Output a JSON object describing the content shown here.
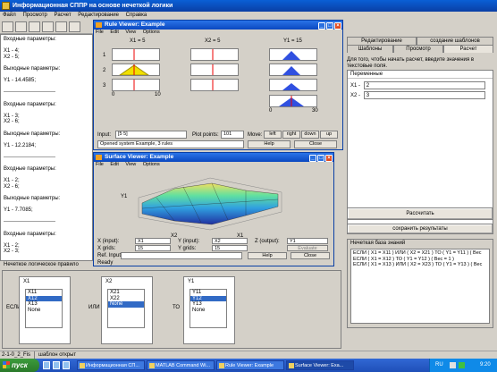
{
  "app": {
    "title": "Информационная СППР на основе нечеткой логики",
    "menu": [
      "Файл",
      "Просмотр",
      "Расчет",
      "Редактирование",
      "Справка"
    ]
  },
  "left_log": [
    "Входные параметры:",
    "",
    "X1 - 4;",
    "X2 - 5;",
    "",
    "Выходные параметры:",
    "",
    "Y1 - 14.4585;",
    "",
    "-----------------------------",
    "",
    "Входные параметры:",
    "",
    "X1 - 3;",
    "X2 - 6;",
    "",
    "Выходные параметры:",
    "",
    "Y1 - 12.2184;",
    "",
    "-----------------------------",
    "",
    "Входные параметры:",
    "",
    "X1 - 2;",
    "X2 - 6;",
    "",
    "Выходные параметры:",
    "",
    "Y1 - 7.7085;",
    "",
    "-----------------------------",
    "",
    "Входные параметры:",
    "",
    "X1 - 2;",
    "X2 - 3;",
    "",
    "Выходные параметры:"
  ],
  "right": {
    "tabs_top": [
      "Редактирование",
      "создание шаблонов"
    ],
    "tabs_bottom": [
      "Шаблоны",
      "Просмотр",
      "Расчет"
    ],
    "hint": "Для того, чтобы начать расчет, введите значения в текстовые поля.",
    "vars_header": "Переменные",
    "x1_label": "X1 -",
    "x1_value": "2",
    "x2_label": "X2 -",
    "x2_value": "3",
    "calc_button": "Рассчитать",
    "save_button": "сохранить результаты",
    "kb_header": "Нечеткая база знаний",
    "kb_rules": [
      "ЕСЛИ ( X1 = X11 ) ИЛИ ( X2 = X21 ) ТО ( Y1 = Y11 ) ( Вес",
      "ЕСЛИ ( X1 = X12 ) ТО ( Y1 = Y12 ) ( Вес = 1 )",
      "ЕСЛИ ( X1 = X13 ) ИЛИ ( X2 = X23 ) ТО ( Y1 = Y13 ) ( Вес"
    ]
  },
  "rule_bar": "Нечеткое логическое правило",
  "rule": {
    "if": "ЕСЛИ",
    "or": "ИЛИ",
    "then": "ТО",
    "x1": {
      "title": "X1",
      "items": [
        "X11",
        "X12",
        "X13",
        "None"
      ],
      "selected": 1
    },
    "x2": {
      "title": "X2",
      "items": [
        "X21",
        "X22",
        "None"
      ],
      "selected": 2
    },
    "y1": {
      "title": "Y1",
      "items": [
        "Y11",
        "Y12",
        "Y13",
        "None"
      ],
      "selected": 1
    }
  },
  "rule_viewer": {
    "title": "Rule Viewer: Example",
    "menu": [
      "File",
      "Edit",
      "View",
      "Options"
    ],
    "col1": "X1 = 5",
    "col2": "X2 = 5",
    "col3": "Y1 = 15",
    "rows": [
      "1",
      "2",
      "3"
    ],
    "ticks_in": [
      "0",
      "10"
    ],
    "ticks_out": [
      "0",
      "30"
    ],
    "input_label": "Input:",
    "input_value": "[5 5]",
    "plot_points_label": "Plot points:",
    "plot_points": "101",
    "move_label": "Move:",
    "left": "left",
    "right": "right",
    "down": "down",
    "up": "up",
    "status": "Opened system Example, 3 rules",
    "help": "Help",
    "close": "Close"
  },
  "surface_viewer": {
    "title": "Surface Viewer: Example",
    "menu": [
      "File",
      "Edit",
      "View",
      "Options"
    ],
    "zlabel": "Y1",
    "xlabel1": "X2",
    "xlabel2": "X1",
    "x_input_label": "X (input):",
    "x_input_value": "X1",
    "y_input_label": "Y (input):",
    "y_input_value": "X2",
    "z_output_label": "Z (output):",
    "z_output_value": "Y1",
    "x_grids_label": "X grids:",
    "x_grids_value": "15",
    "y_grids_label": "Y grids:",
    "y_grids_value": "15",
    "evaluate": "Evaluate",
    "ref_input_label": "Ref. Input:",
    "help": "Help",
    "close": "Close",
    "status": "Ready"
  },
  "statusbar": {
    "left": "2-1-0_2_Fis",
    "right": "шаблон открыт"
  },
  "taskbar": {
    "start": "пуск",
    "tasks": [
      "Информационная СП...",
      "MATLAB Command Wi...",
      "Rule Viewer: Example",
      "Surface Viewer: Exa..."
    ],
    "lang": "RU",
    "clock": "9:20"
  }
}
